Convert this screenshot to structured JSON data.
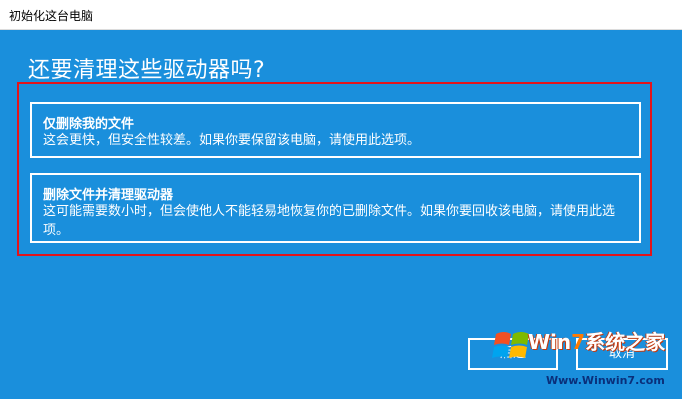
{
  "window": {
    "title": "初始化这台电脑"
  },
  "main": {
    "heading": "还要清理这些驱动器吗?",
    "options": [
      {
        "title": "仅删除我的文件",
        "description": "这会更快，但安全性较差。如果你要保留该电脑，请使用此选项。"
      },
      {
        "title": "删除文件并清理驱动器",
        "description": "这可能需要数小时，但会使他人不能轻易地恢复你的已删除文件。如果你要回收该电脑，请使用此选项。"
      }
    ]
  },
  "buttons": {
    "back": "后退",
    "cancel": "取消"
  },
  "watermark": {
    "name_prefix": "Win",
    "name_digit": "7",
    "name_suffix": "系统之家",
    "url": "Www.Winwin7.com"
  },
  "colors": {
    "background": "#1a8fdc",
    "highlight": "#e3141b",
    "titlebar": "#ffffff"
  }
}
